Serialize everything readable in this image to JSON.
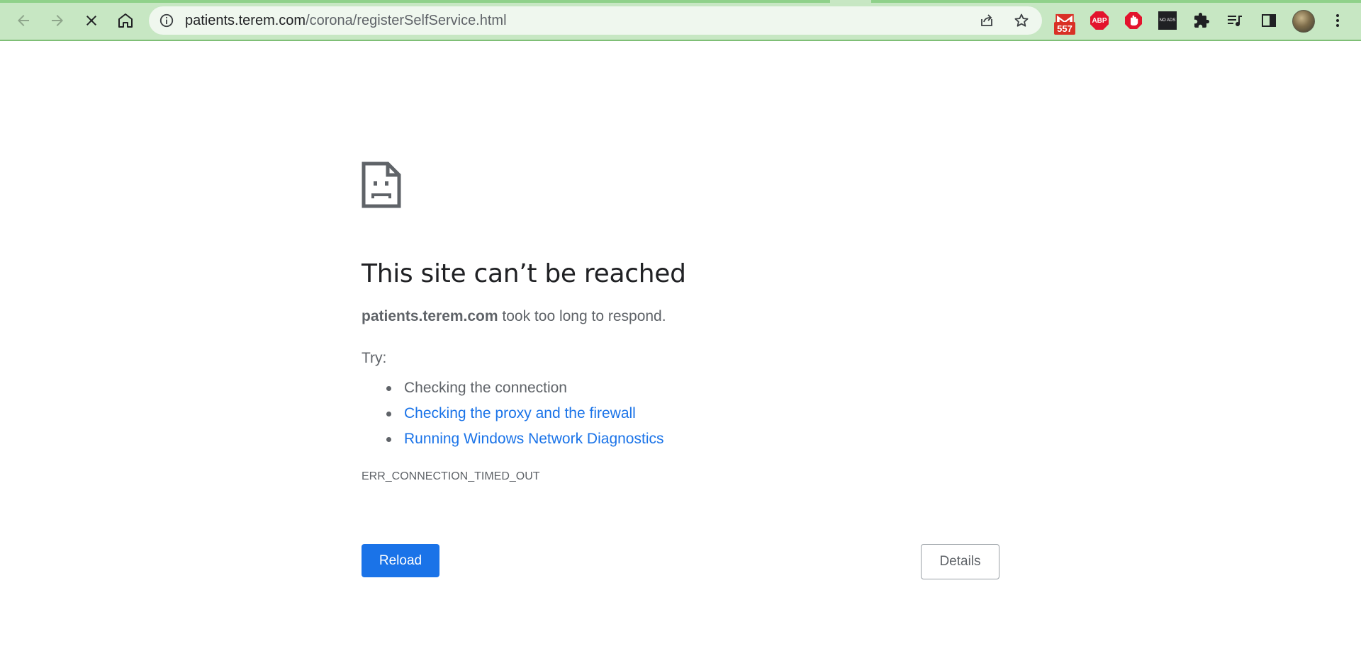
{
  "browser": {
    "url_host": "patients.terem.com",
    "url_path": "/corona/registerSelfService.html",
    "extensions": [
      {
        "name": "gmail-notifier",
        "badge": "557"
      },
      {
        "name": "adblock-plus",
        "label": "ABP"
      },
      {
        "name": "adblock-hand"
      },
      {
        "name": "no-ads",
        "label": "NO ADS"
      },
      {
        "name": "extensions-puzzle"
      },
      {
        "name": "media-queue"
      },
      {
        "name": "side-panel"
      },
      {
        "name": "profile-avatar"
      }
    ],
    "theme_color": "#c7e7c3"
  },
  "error_page": {
    "heading": "This site can’t be reached",
    "host": "patients.terem.com",
    "message": " took too long to respond.",
    "try_label": "Try:",
    "suggestions": [
      "Checking the connection",
      "Checking the proxy and the firewall",
      "Running Windows Network Diagnostics"
    ],
    "error_code": "ERR_CONNECTION_TIMED_OUT",
    "reload_label": "Reload",
    "details_label": "Details",
    "link_color": "#1a73e8"
  }
}
